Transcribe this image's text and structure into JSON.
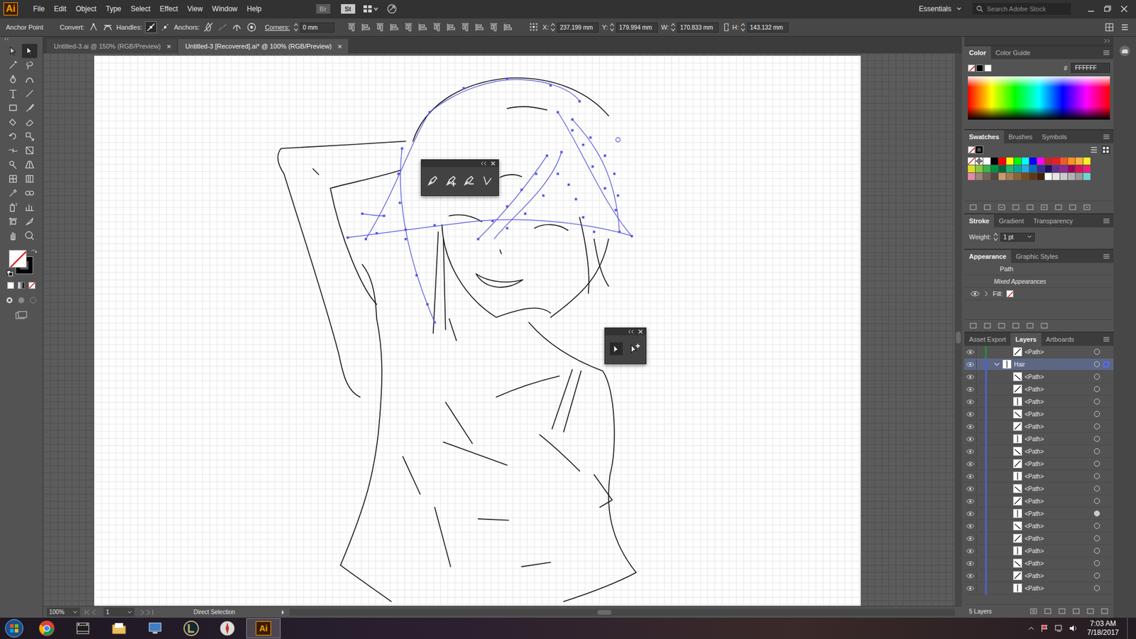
{
  "app": {
    "logo": "Ai",
    "menus": [
      "File",
      "Edit",
      "Object",
      "Type",
      "Select",
      "Effect",
      "View",
      "Window",
      "Help"
    ],
    "bridge": "Br",
    "stock": "St",
    "workspace": "Essentials",
    "search": {
      "placeholder": "Search Adobe Stock"
    }
  },
  "control_bar": {
    "tool": "Anchor Point",
    "convert": "Convert:",
    "handles": "Handles:",
    "anchors": "Anchors:",
    "corners": "Corners:",
    "corner_value": "0 mm",
    "fields": [
      {
        "label": "X:",
        "value": "237.199 mm"
      },
      {
        "label": "Y:",
        "value": "179.994 mm"
      },
      {
        "label": "W:",
        "value": "170.833 mm"
      },
      {
        "label": "H:",
        "value": "143.132 mm"
      }
    ]
  },
  "tabs": [
    {
      "label": "Untitled-3.ai @ 150% (RGB/Preview)",
      "selected": false,
      "close": "×"
    },
    {
      "label": "Untitled-3 [Recovered].ai* @ 100% (RGB/Preview)",
      "selected": true,
      "close": "×"
    }
  ],
  "tools": [
    {
      "kind": "selection",
      "selected": false
    },
    {
      "kind": "direct-selection",
      "selected": true
    },
    {
      "kind": "magic-wand",
      "selected": false
    },
    {
      "kind": "lasso",
      "selected": false
    },
    {
      "kind": "pen",
      "selected": false
    },
    {
      "kind": "curvature",
      "selected": false
    },
    {
      "kind": "type",
      "selected": false
    },
    {
      "kind": "line",
      "selected": false
    },
    {
      "kind": "rectangle",
      "selected": false
    },
    {
      "kind": "paintbrush",
      "selected": false
    },
    {
      "kind": "shaper",
      "selected": false
    },
    {
      "kind": "eraser",
      "selected": false
    },
    {
      "kind": "rotate",
      "selected": false
    },
    {
      "kind": "scale",
      "selected": false
    },
    {
      "kind": "width",
      "selected": false
    },
    {
      "kind": "free-transform",
      "selected": false
    },
    {
      "kind": "shape-builder",
      "selected": false
    },
    {
      "kind": "perspective",
      "selected": false
    },
    {
      "kind": "mesh",
      "selected": false
    },
    {
      "kind": "gradient",
      "selected": false
    },
    {
      "kind": "eyedropper",
      "selected": false
    },
    {
      "kind": "blend",
      "selected": false
    },
    {
      "kind": "symbol-sprayer",
      "selected": false
    },
    {
      "kind": "graph",
      "selected": false
    },
    {
      "kind": "artboard",
      "selected": false
    },
    {
      "kind": "slice",
      "selected": false
    },
    {
      "kind": "hand",
      "selected": false
    },
    {
      "kind": "zoom",
      "selected": false
    }
  ],
  "fill_stroke": {
    "fill": "none",
    "stroke": "#000000"
  },
  "panels": {
    "color": {
      "tabs": [
        {
          "label": "Color",
          "selected": true
        },
        {
          "label": "Color Guide",
          "selected": false
        }
      ],
      "hash": "#",
      "hex": "FFFFFF"
    },
    "swatches": {
      "tabs": [
        {
          "label": "Swatches",
          "selected": true
        },
        {
          "label": "Brushes",
          "selected": false
        },
        {
          "label": "Symbols",
          "selected": false
        }
      ],
      "items": [
        {
          "kind": "none",
          "color": "#ffffff"
        },
        {
          "kind": "registration",
          "color": "#000000"
        },
        {
          "kind": "color",
          "color": "#ffffff"
        },
        {
          "kind": "color",
          "color": "#000000"
        },
        {
          "kind": "color",
          "color": "#ff0000"
        },
        {
          "kind": "color",
          "color": "#ffff00"
        },
        {
          "kind": "color",
          "color": "#00ff00"
        },
        {
          "kind": "color",
          "color": "#00ffff"
        },
        {
          "kind": "color",
          "color": "#0000ff"
        },
        {
          "kind": "color",
          "color": "#ff00ff"
        },
        {
          "kind": "color",
          "color": "#c1272d"
        },
        {
          "kind": "color",
          "color": "#ed1c24"
        },
        {
          "kind": "color",
          "color": "#f15a24"
        },
        {
          "kind": "color",
          "color": "#f7931e"
        },
        {
          "kind": "color",
          "color": "#fbb03b"
        },
        {
          "kind": "color",
          "color": "#fcee21"
        },
        {
          "kind": "color",
          "color": "#d9e021"
        },
        {
          "kind": "color",
          "color": "#8cc63f"
        },
        {
          "kind": "color",
          "color": "#39b54a"
        },
        {
          "kind": "color",
          "color": "#009245"
        },
        {
          "kind": "color",
          "color": "#006837"
        },
        {
          "kind": "color",
          "color": "#22b573"
        },
        {
          "kind": "color",
          "color": "#00a99d"
        },
        {
          "kind": "color",
          "color": "#29abe2"
        },
        {
          "kind": "color",
          "color": "#0071bc"
        },
        {
          "kind": "color",
          "color": "#2e3192"
        },
        {
          "kind": "color",
          "color": "#1b1464"
        },
        {
          "kind": "color",
          "color": "#662d91"
        },
        {
          "kind": "color",
          "color": "#93278f"
        },
        {
          "kind": "color",
          "color": "#9e005d"
        },
        {
          "kind": "color",
          "color": "#d4145a"
        },
        {
          "kind": "color",
          "color": "#ed1e79"
        },
        {
          "kind": "color",
          "color": "#e58aa8"
        },
        {
          "kind": "color",
          "color": "#998675"
        },
        {
          "kind": "color",
          "color": "#736357"
        },
        {
          "kind": "color",
          "color": "#534741"
        },
        {
          "kind": "color",
          "color": "#c69c6d"
        },
        {
          "kind": "color",
          "color": "#a67c52"
        },
        {
          "kind": "color",
          "color": "#8c6239"
        },
        {
          "kind": "color",
          "color": "#754c24"
        },
        {
          "kind": "color",
          "color": "#603813"
        },
        {
          "kind": "color",
          "color": "#42210b"
        },
        {
          "kind": "color",
          "color": "#ffffff"
        },
        {
          "kind": "color",
          "color": "#e6e6e6"
        },
        {
          "kind": "color",
          "color": "#cccccc"
        },
        {
          "kind": "color",
          "color": "#b3b3b3"
        },
        {
          "kind": "color",
          "color": "#999999"
        },
        {
          "kind": "color",
          "color": "#6fd4d4"
        }
      ]
    },
    "stroke": {
      "tabs": [
        {
          "label": "Stroke",
          "selected": true
        },
        {
          "label": "Gradient",
          "selected": false
        },
        {
          "label": "Transparency",
          "selected": false
        }
      ],
      "weight_label": "Weight:",
      "weight": "1 pt"
    },
    "appearance": {
      "tabs": [
        {
          "label": "Appearance",
          "selected": true
        },
        {
          "label": "Graphic Styles",
          "selected": false
        }
      ],
      "object": "Path",
      "note": "Mixed Appearances",
      "fill_label": "Fill:"
    },
    "layers": {
      "tabs": [
        {
          "label": "Asset Export",
          "selected": false
        },
        {
          "label": "Layers",
          "selected": true
        },
        {
          "label": "Artboards",
          "selected": false
        }
      ],
      "rows": [
        {
          "label": "<Path>",
          "kind": "path",
          "visible": true,
          "selected": false,
          "targeted": false,
          "expanded": false,
          "color": "#2f8a3a"
        },
        {
          "label": "Hair",
          "kind": "layer",
          "visible": true,
          "selected": true,
          "targeted": false,
          "expanded": true,
          "color": "#4f5fd6"
        },
        {
          "label": "<Path>",
          "kind": "path",
          "visible": true,
          "selected": false,
          "targeted": false,
          "expanded": false,
          "color": "#4f5fd6"
        },
        {
          "label": "<Path>",
          "kind": "path",
          "visible": true,
          "selected": false,
          "targeted": false,
          "expanded": false,
          "color": "#4f5fd6"
        },
        {
          "label": "<Path>",
          "kind": "path",
          "visible": true,
          "selected": false,
          "targeted": false,
          "expanded": false,
          "color": "#4f5fd6"
        },
        {
          "label": "<Path>",
          "kind": "path",
          "visible": true,
          "selected": false,
          "targeted": false,
          "expanded": false,
          "color": "#4f5fd6"
        },
        {
          "label": "<Path>",
          "kind": "path",
          "visible": true,
          "selected": false,
          "targeted": false,
          "expanded": false,
          "color": "#4f5fd6"
        },
        {
          "label": "<Path>",
          "kind": "path",
          "visible": true,
          "selected": false,
          "targeted": false,
          "expanded": false,
          "color": "#4f5fd6"
        },
        {
          "label": "<Path>",
          "kind": "path",
          "visible": true,
          "selected": false,
          "targeted": false,
          "expanded": false,
          "color": "#4f5fd6"
        },
        {
          "label": "<Path>",
          "kind": "path",
          "visible": true,
          "selected": false,
          "targeted": false,
          "expanded": false,
          "color": "#4f5fd6"
        },
        {
          "label": "<Path>",
          "kind": "path",
          "visible": true,
          "selected": false,
          "targeted": false,
          "expanded": false,
          "color": "#4f5fd6"
        },
        {
          "label": "<Path>",
          "kind": "path",
          "visible": true,
          "selected": false,
          "targeted": false,
          "expanded": false,
          "color": "#4f5fd6"
        },
        {
          "label": "<Path>",
          "kind": "path",
          "visible": true,
          "selected": false,
          "targeted": false,
          "expanded": false,
          "color": "#4f5fd6"
        },
        {
          "label": "<Path>",
          "kind": "path",
          "visible": true,
          "selected": false,
          "targeted": true,
          "expanded": false,
          "color": "#4f5fd6"
        },
        {
          "label": "<Path>",
          "kind": "path",
          "visible": true,
          "selected": false,
          "targeted": false,
          "expanded": false,
          "color": "#4f5fd6"
        },
        {
          "label": "<Path>",
          "kind": "path",
          "visible": true,
          "selected": false,
          "targeted": false,
          "expanded": false,
          "color": "#4f5fd6"
        },
        {
          "label": "<Path>",
          "kind": "path",
          "visible": true,
          "selected": false,
          "targeted": false,
          "expanded": false,
          "color": "#4f5fd6"
        },
        {
          "label": "<Path>",
          "kind": "path",
          "visible": true,
          "selected": false,
          "targeted": false,
          "expanded": false,
          "color": "#4f5fd6"
        },
        {
          "label": "<Path>",
          "kind": "path",
          "visible": true,
          "selected": false,
          "targeted": false,
          "expanded": false,
          "color": "#4f5fd6"
        },
        {
          "label": "<Path>",
          "kind": "path",
          "visible": true,
          "selected": false,
          "targeted": false,
          "expanded": false,
          "color": "#4f5fd6"
        }
      ],
      "footer": "5 Layers"
    }
  },
  "status_bar": {
    "zoom": "100%",
    "artboard": "1",
    "tool": "Direct Selection"
  },
  "taskbar": {
    "time": "7:03 AM",
    "date": "7/18/2017"
  }
}
